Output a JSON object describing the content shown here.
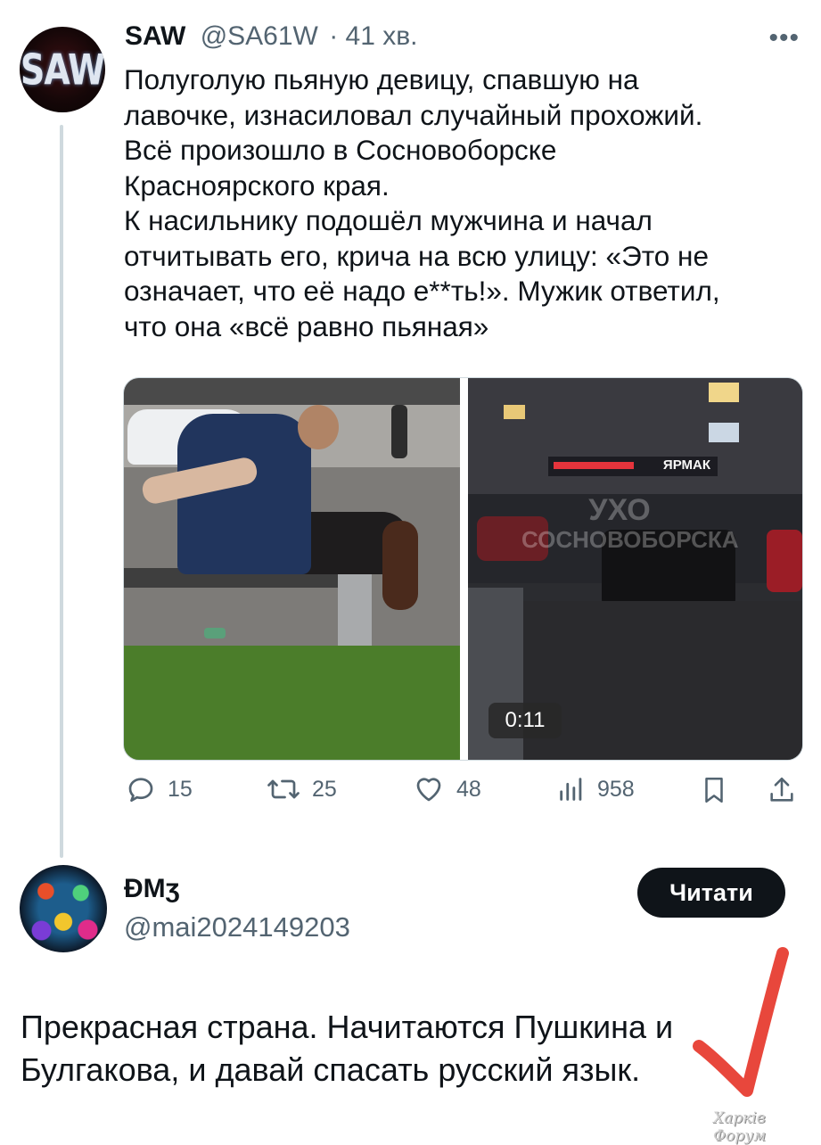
{
  "tweet": {
    "author_name": "SAW",
    "author_handle": "@SA61W",
    "time": "· 41 хв.",
    "avatar_text": "SAW",
    "more_label": "•••",
    "text": "Полуголую пьяную девицу, спавшую на\nлавочке, изнасиловал случайный прохожий.\nВсё произошло в Сосновоборске\nКрасноярского края.\nК насильнику подошёл мужчина и начал\nотчитывать его, крича на всю улицу: «Это не\nозначает, что её надо е**ть!». Мужик ответил,\nчто она «всё равно пьяная»",
    "media": {
      "video_duration": "0:11",
      "store_sign": "ЯРМАК",
      "watermark_line1": "УХО",
      "watermark_line2": "СОСНОВОБОРСКА"
    },
    "actions": {
      "replies": "15",
      "retweets": "25",
      "likes": "48",
      "views": "958"
    }
  },
  "reply": {
    "author_name": "ĐMʒ",
    "author_handle": "@mai2024149203",
    "follow_label": "Читати",
    "text": "Прекрасная страна. Начитаются Пушкина и\nБулгакова, и давай спасать русский язык."
  },
  "overlay": {
    "watermark": "Харків Форум",
    "checkmark_color": "#e8473c"
  },
  "colors": {
    "text_primary": "#0f1419",
    "text_secondary": "#536471",
    "divider": "#cfd9de"
  }
}
